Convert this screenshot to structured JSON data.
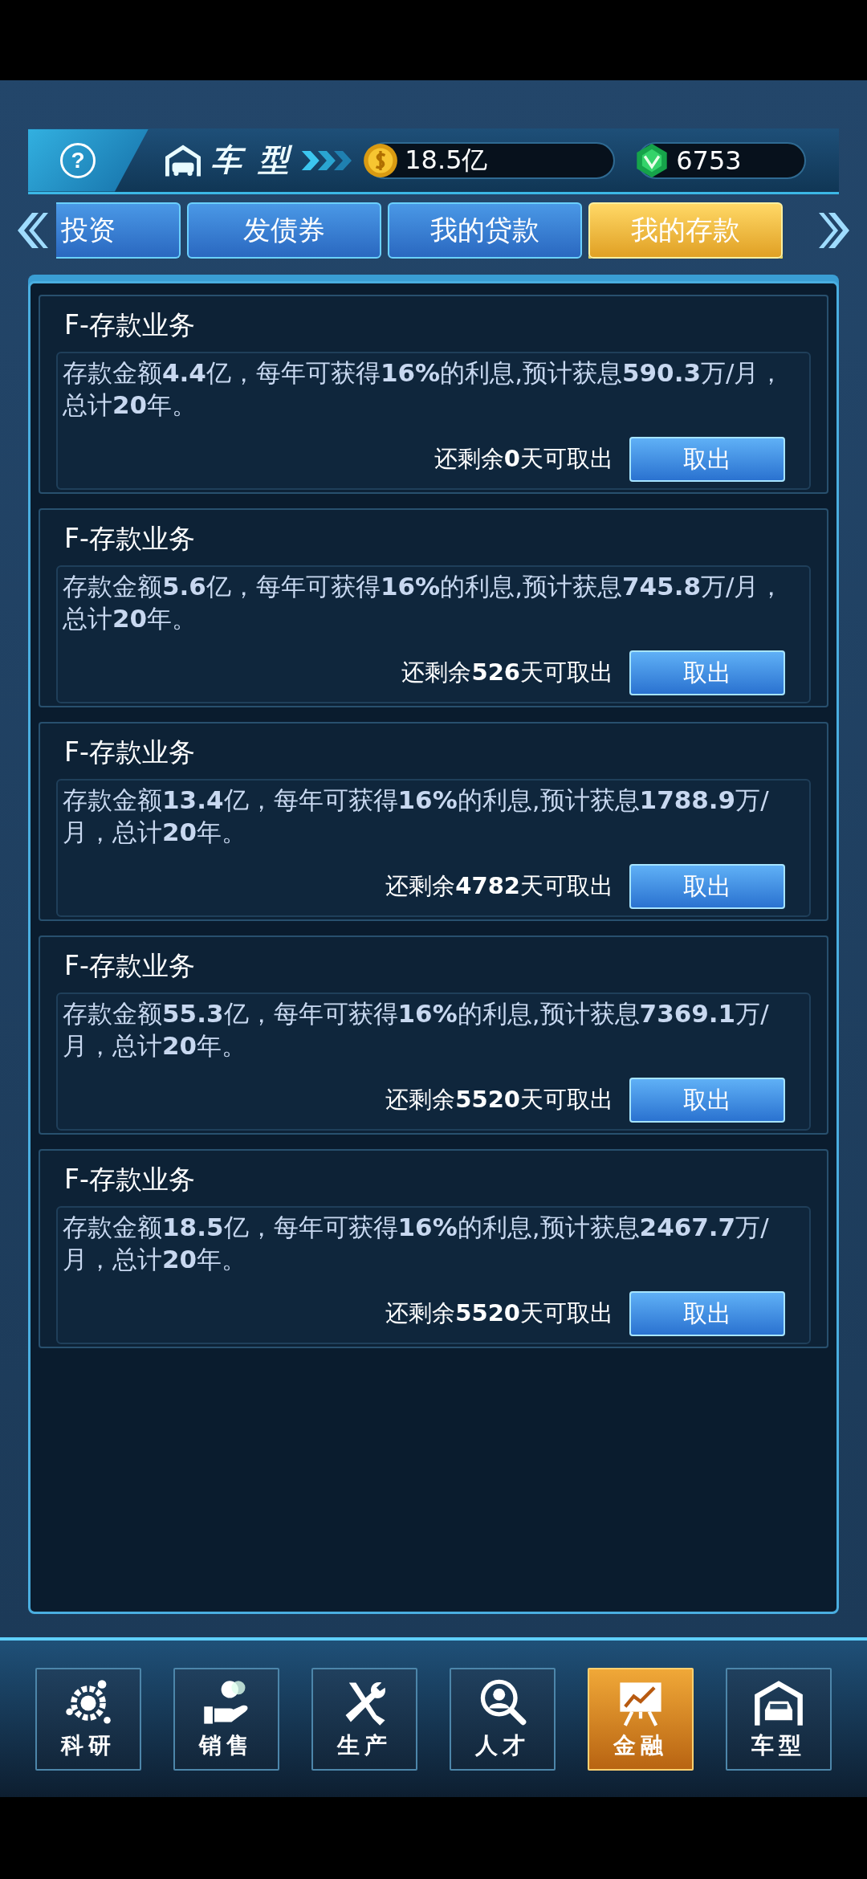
{
  "header": {
    "help": "?",
    "title": "车 型",
    "coins": "18.5亿",
    "gems": "6753"
  },
  "tabs": [
    {
      "label": "投资",
      "selected": false
    },
    {
      "label": "发债券",
      "selected": false
    },
    {
      "label": "我的贷款",
      "selected": false
    },
    {
      "label": "我的存款",
      "selected": true
    }
  ],
  "deposits": [
    {
      "title": "F-存款业务",
      "description": "存款金额**4.4**亿，每年可获得**16%**的利息,预计获息**590.3**万/月，总计**20**年。",
      "remaining": "还剩余**0**天可取出",
      "button": "取出"
    },
    {
      "title": "F-存款业务",
      "description": "存款金额**5.6**亿，每年可获得**16%**的利息,预计获息**745.8**万/月，总计**20**年。",
      "remaining": "还剩余**526**天可取出",
      "button": "取出"
    },
    {
      "title": "F-存款业务",
      "description": "存款金额**13.4**亿，每年可获得**16%**的利息,预计获息**1788.9**万/月，总计**20**年。",
      "remaining": "还剩余**4782**天可取出",
      "button": "取出"
    },
    {
      "title": "F-存款业务",
      "description": "存款金额**55.3**亿，每年可获得**16%**的利息,预计获息**7369.1**万/月，总计**20**年。",
      "remaining": "还剩余**5520**天可取出",
      "button": "取出"
    },
    {
      "title": "F-存款业务",
      "description": "存款金额**18.5**亿，每年可获得**16%**的利息,预计获息**2467.7**万/月，总计**20**年。",
      "remaining": "还剩余**5520**天可取出",
      "button": "取出"
    }
  ],
  "nav": [
    {
      "label": "科研",
      "kind": "research",
      "selected": false
    },
    {
      "label": "销售",
      "kind": "sales",
      "selected": false
    },
    {
      "label": "生产",
      "kind": "production",
      "selected": false
    },
    {
      "label": "人才",
      "kind": "talent",
      "selected": false
    },
    {
      "label": "金融",
      "kind": "finance",
      "selected": true
    },
    {
      "label": "车型",
      "kind": "garage",
      "selected": false
    }
  ]
}
